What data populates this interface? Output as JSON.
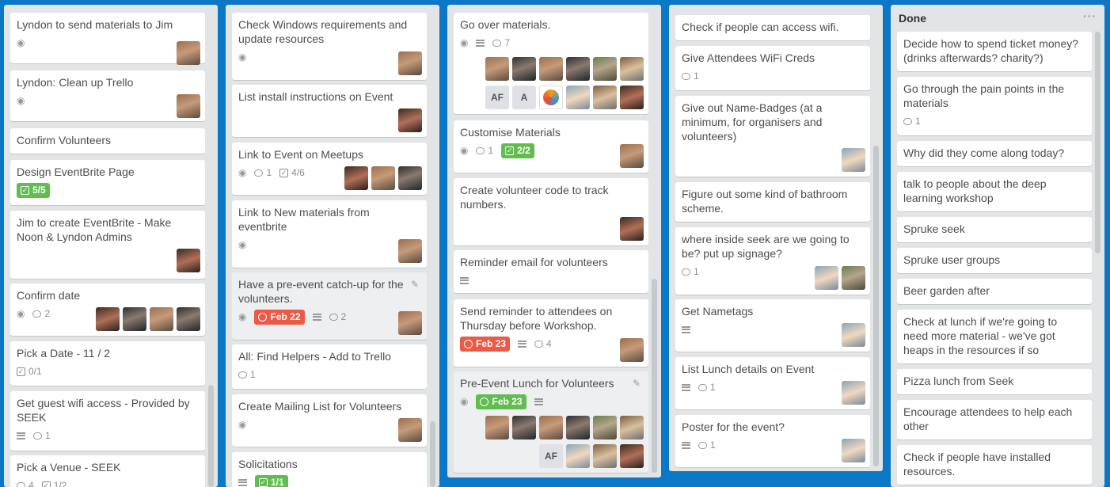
{
  "lists": {
    "l1": {
      "c1": {
        "title": "Lyndon to send materials to Jim"
      },
      "c2": {
        "title": "Lyndon: Clean up Trello"
      },
      "c3": {
        "title": "Confirm Volunteers"
      },
      "c4": {
        "title": "Design EventBrite Page",
        "checklist": "5/5"
      },
      "c5": {
        "title": "Jim to create EventBrite - Make Noon & Lyndon Admins"
      },
      "c6": {
        "title": "Confirm date",
        "comments": "2"
      },
      "c7": {
        "title": "Pick a Date - 11 / 2",
        "checklist": "0/1"
      },
      "c8": {
        "title": "Get guest wifi access - Provided by SEEK",
        "comments": "1"
      },
      "c9": {
        "title": "Pick a Venue - SEEK",
        "comments": "4",
        "checklist": "1/2"
      }
    },
    "l2": {
      "c1": {
        "title": "Check Windows requirements and update resources"
      },
      "c2": {
        "title": "List install instructions on Event"
      },
      "c3": {
        "title": "Link to Event on Meetups",
        "comments": "1",
        "checklist": "4/6"
      },
      "c4": {
        "title": "Link to New materials from eventbrite"
      },
      "c5": {
        "title": "Have a pre-event catch-up for the volunteers.",
        "due": "Feb 22",
        "comments": "2"
      },
      "c6": {
        "title": "All: Find Helpers - Add to Trello",
        "comments": "1"
      },
      "c7": {
        "title": "Create Mailing List for Volunteers"
      },
      "c8": {
        "title": "Solicitations",
        "checklist": "1/1"
      }
    },
    "l3": {
      "c1": {
        "title": "Go over materials.",
        "comments": "7",
        "initials1": "AF",
        "initials2": "A"
      },
      "c2": {
        "title": "Customise Materials",
        "comments": "1",
        "checklist": "2/2"
      },
      "c3": {
        "title": "Create volunteer code to track numbers."
      },
      "c4": {
        "title": "Reminder email for volunteers"
      },
      "c5": {
        "title": "Send reminder to attendees on Thursday before Workshop.",
        "due": "Feb 23",
        "comments": "4"
      },
      "c6": {
        "title": "Pre-Event Lunch for Volunteers",
        "due": "Feb 23",
        "initials": "AF"
      }
    },
    "l4": {
      "c1": {
        "title": "Check if people can access wifi."
      },
      "c2": {
        "title": "Give Attendees WiFi Creds",
        "comments": "1"
      },
      "c3": {
        "title": "Give out Name-Badges (at a minimum, for organisers and volunteers)"
      },
      "c4": {
        "title": "Figure out some kind of bathroom scheme."
      },
      "c5": {
        "title": "where inside seek are we going to be? put up signage?",
        "comments": "1"
      },
      "c6": {
        "title": "Get Nametags"
      },
      "c7": {
        "title": "List Lunch details on Event",
        "comments": "1"
      },
      "c8": {
        "title": "Poster for the event?",
        "comments": "1"
      }
    },
    "l5": {
      "name": "Done",
      "menu": "···",
      "c1": {
        "title": "Decide how to spend ticket money? (drinks afterwards? charity?)"
      },
      "c2": {
        "title": "Go through the pain points in the materials",
        "comments": "1"
      },
      "c3": {
        "title": "Why did they come along today?"
      },
      "c4": {
        "title": "talk to people about the deep learning workshop"
      },
      "c5": {
        "title": "Spruke seek"
      },
      "c6": {
        "title": "Spruke user groups"
      },
      "c7": {
        "title": "Beer garden after"
      },
      "c8": {
        "title": "Check at lunch if we're going to need more material - we've got heaps in the resources if so"
      },
      "c9": {
        "title": "Pizza lunch from Seek"
      },
      "c10": {
        "title": "Encourage attendees to help each other"
      },
      "c11": {
        "title": "Check if people have installed resources."
      }
    }
  },
  "icons": {
    "eye": "◉",
    "check": "✓",
    "pencil": "✎"
  },
  "colors": {
    "board": "#0a78c6",
    "list": "#e2e4e6",
    "label_green": "#61bd4f",
    "label_red": "#eb5a46"
  }
}
